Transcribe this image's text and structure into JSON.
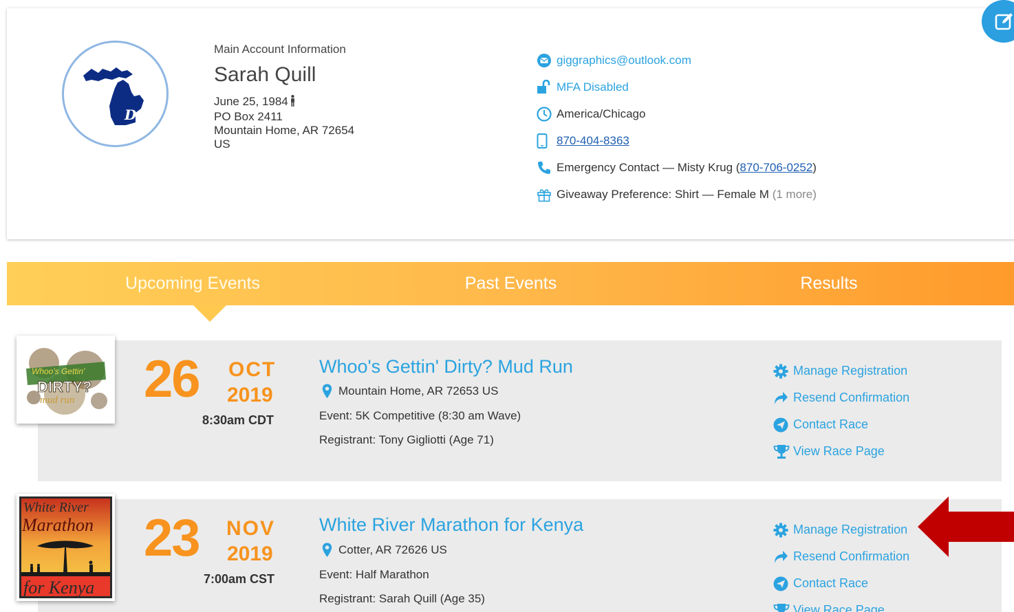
{
  "account": {
    "section_label": "Main Account Information",
    "name": "Sarah Quill",
    "dob": "June 25, 1984",
    "address1": "PO Box 2411",
    "address2": "Mountain Home, AR 72654",
    "country": "US",
    "avatar_icon": "michigan-detroit-logo"
  },
  "contacts": {
    "email": "giggraphics@outlook.com",
    "mfa": "MFA Disabled",
    "timezone": "America/Chicago",
    "phone": "870-404-8363",
    "emergency_prefix": "Emergency Contact — Misty Krug (",
    "emergency_phone": "870-706-0252",
    "emergency_suffix": ")",
    "giveaway": "Giveaway Preference: Shirt — Female M",
    "giveaway_more": "(1 more)"
  },
  "tabs": {
    "upcoming": "Upcoming Events",
    "past": "Past Events",
    "results": "Results"
  },
  "events": [
    {
      "day": "26",
      "month": "OCT",
      "year": "2019",
      "time": "8:30am CDT",
      "title": "Whoo's Gettin' Dirty? Mud Run",
      "location": "Mountain Home, AR 72653 US",
      "event": "Event: 5K Competitive (8:30 am Wave)",
      "registrant": "Registrant: Tony Gigliotti (Age 71)",
      "logo_text1": "Whoo's Gettin'",
      "logo_text2": "DIRTY?",
      "logo_text3": "mud run"
    },
    {
      "day": "23",
      "month": "NOV",
      "year": "2019",
      "time": "7:00am CST",
      "title": "White River Marathon for Kenya",
      "location": "Cotter, AR 72626 US",
      "event": "Event: Half Marathon",
      "registrant": "Registrant: Sarah Quill (Age 35)",
      "logo_text1": "White River",
      "logo_text2": "Marathon",
      "logo_text3": "for Kenya"
    }
  ],
  "actions": {
    "manage": "Manage Registration",
    "resend": "Resend Confirmation",
    "contact": "Contact Race",
    "view": "View Race Page"
  },
  "colors": {
    "accent_blue": "#2ba3e0",
    "date_orange": "#f7931e",
    "arrow_red": "#c00000"
  }
}
